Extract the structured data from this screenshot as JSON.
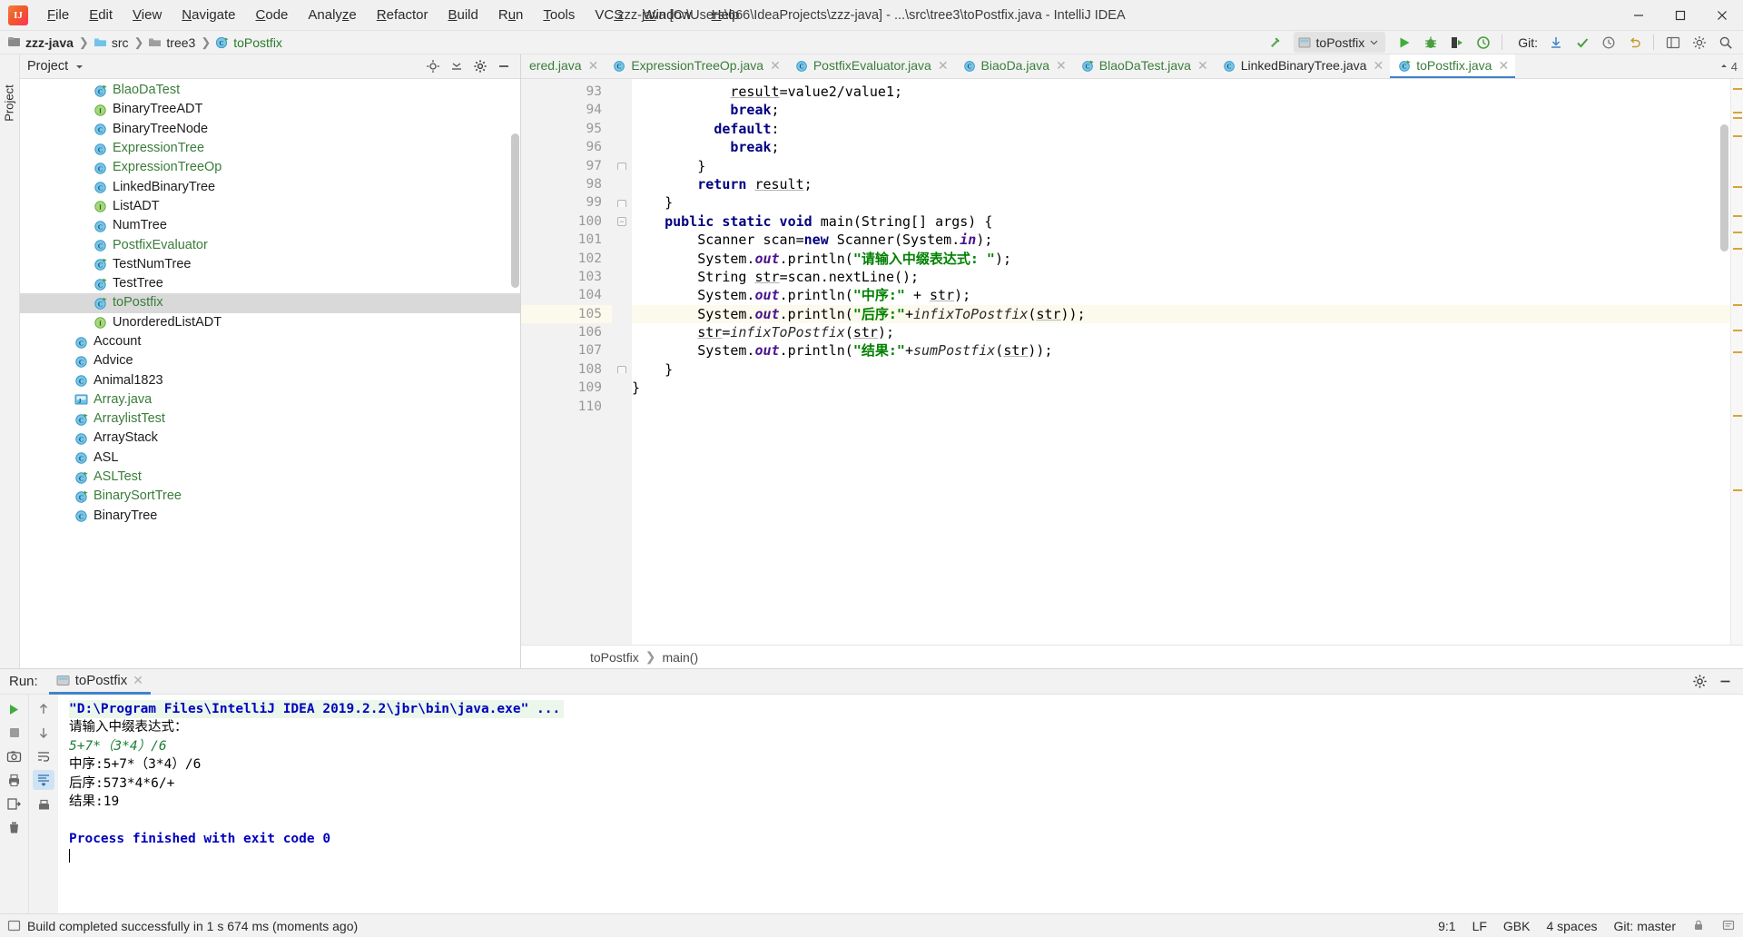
{
  "window": {
    "title": "zzz-java [C:\\Users\\666\\IdeaProjects\\zzz-java] - ...\\src\\tree3\\toPostfix.java - IntelliJ IDEA",
    "minimize": "—",
    "maximize": "☐",
    "close": "✕"
  },
  "menu": [
    "File",
    "Edit",
    "View",
    "Navigate",
    "Code",
    "Analyze",
    "Refactor",
    "Build",
    "Run",
    "Tools",
    "VCS",
    "Window",
    "Help"
  ],
  "breadcrumb": [
    {
      "label": "zzz-java",
      "icon": "project-icon",
      "style": "bold"
    },
    {
      "label": "src",
      "icon": "folder-icon",
      "style": "normal"
    },
    {
      "label": "tree3",
      "icon": "folder-icon",
      "style": "normal"
    },
    {
      "label": "toPostfix",
      "icon": "java-class-icon",
      "style": "green"
    }
  ],
  "toolbar": {
    "run_config_name": "toPostfix",
    "git_label": "Git:",
    "icons": [
      "build-hammer-icon",
      "run-icon",
      "debug-icon",
      "run-with-coverage-icon",
      "profile-icon",
      "vcs-update-icon",
      "vcs-commit-icon",
      "vcs-history-icon",
      "undo-icon",
      "settings-icon",
      "search-icon"
    ]
  },
  "project_panel": {
    "title": "Project",
    "header_icons": [
      "locate-icon",
      "collapse-all-icon",
      "settings-gear-icon",
      "hide-icon"
    ],
    "items": [
      {
        "label": "BlaoDaTest",
        "icon": "class-runnable",
        "green": true,
        "indent": 3
      },
      {
        "label": "BinaryTreeADT",
        "icon": "interface",
        "green": false,
        "indent": 3
      },
      {
        "label": "BinaryTreeNode",
        "icon": "class",
        "green": false,
        "indent": 3
      },
      {
        "label": "ExpressionTree",
        "icon": "class",
        "green": true,
        "indent": 3
      },
      {
        "label": "ExpressionTreeOp",
        "icon": "class",
        "green": true,
        "indent": 3
      },
      {
        "label": "LinkedBinaryTree",
        "icon": "class",
        "green": false,
        "indent": 3
      },
      {
        "label": "ListADT",
        "icon": "interface",
        "green": false,
        "indent": 3
      },
      {
        "label": "NumTree",
        "icon": "class",
        "green": false,
        "indent": 3
      },
      {
        "label": "PostfixEvaluator",
        "icon": "class",
        "green": true,
        "indent": 3
      },
      {
        "label": "TestNumTree",
        "icon": "class-runnable",
        "green": false,
        "indent": 3
      },
      {
        "label": "TestTree",
        "icon": "class-runnable",
        "green": false,
        "indent": 3
      },
      {
        "label": "toPostfix",
        "icon": "class-runnable",
        "green": true,
        "indent": 3,
        "selected": true
      },
      {
        "label": "UnorderedListADT",
        "icon": "interface",
        "green": false,
        "indent": 3
      },
      {
        "label": "Account",
        "icon": "class",
        "green": false,
        "indent": 2
      },
      {
        "label": "Advice",
        "icon": "class",
        "green": false,
        "indent": 2
      },
      {
        "label": "Animal1823",
        "icon": "class",
        "green": false,
        "indent": 2
      },
      {
        "label": "Array.java",
        "icon": "java-file",
        "green": true,
        "indent": 2
      },
      {
        "label": "ArraylistTest",
        "icon": "class-runnable",
        "green": true,
        "indent": 2
      },
      {
        "label": "ArrayStack",
        "icon": "class",
        "green": false,
        "indent": 2
      },
      {
        "label": "ASL",
        "icon": "class",
        "green": false,
        "indent": 2
      },
      {
        "label": "ASLTest",
        "icon": "class-runnable",
        "green": true,
        "indent": 2
      },
      {
        "label": "BinarySortTree",
        "icon": "class-runnable",
        "green": true,
        "indent": 2
      },
      {
        "label": "BinaryTree",
        "icon": "class",
        "green": false,
        "indent": 2
      }
    ]
  },
  "editor_tabs": [
    {
      "label": "ered.java",
      "green": true,
      "icon": "java-class-icon",
      "active": false,
      "clipped": true
    },
    {
      "label": "ExpressionTreeOp.java",
      "green": true,
      "icon": "java-class-icon",
      "active": false
    },
    {
      "label": "PostfixEvaluator.java",
      "green": true,
      "icon": "java-class-icon",
      "active": false
    },
    {
      "label": "BiaoDa.java",
      "green": true,
      "icon": "java-class-icon",
      "active": false
    },
    {
      "label": "BlaoDaTest.java",
      "green": true,
      "icon": "java-class-runnable-icon",
      "active": false
    },
    {
      "label": "LinkedBinaryTree.java",
      "green": false,
      "icon": "java-class-icon",
      "active": false
    },
    {
      "label": "toPostfix.java",
      "green": true,
      "icon": "java-class-runnable-icon",
      "active": true
    }
  ],
  "tab_overflow_count": "4",
  "editor": {
    "first_line": 93,
    "highlight_line": 105,
    "run_marker_line": 100,
    "lines": [
      {
        "n": 93,
        "indent": 12,
        "tokens": [
          {
            "t": "result",
            "c": "var-u"
          },
          {
            "t": "=value2/value1;",
            "c": ""
          }
        ]
      },
      {
        "n": 94,
        "indent": 12,
        "tokens": [
          {
            "t": "break",
            "c": "kw"
          },
          {
            "t": ";",
            "c": ""
          }
        ]
      },
      {
        "n": 95,
        "indent": 10,
        "tokens": [
          {
            "t": "default",
            "c": "kw"
          },
          {
            "t": ":",
            "c": ""
          }
        ]
      },
      {
        "n": 96,
        "indent": 12,
        "tokens": [
          {
            "t": "break",
            "c": "kw"
          },
          {
            "t": ";",
            "c": ""
          }
        ]
      },
      {
        "n": 97,
        "indent": 8,
        "tokens": [
          {
            "t": "}",
            "c": ""
          }
        ],
        "fold": "end"
      },
      {
        "n": 98,
        "indent": 8,
        "tokens": [
          {
            "t": "return",
            "c": "kw"
          },
          {
            "t": " ",
            "c": ""
          },
          {
            "t": "result",
            "c": "var-u"
          },
          {
            "t": ";",
            "c": ""
          }
        ]
      },
      {
        "n": 99,
        "indent": 4,
        "tokens": [
          {
            "t": "}",
            "c": ""
          }
        ],
        "fold": "end"
      },
      {
        "n": 100,
        "indent": 4,
        "tokens": [
          {
            "t": "public static void",
            "c": "kw"
          },
          {
            "t": " main(String[] args) {",
            "c": ""
          }
        ],
        "fold": "start",
        "run": true
      },
      {
        "n": 101,
        "indent": 8,
        "tokens": [
          {
            "t": "Scanner scan=",
            "c": ""
          },
          {
            "t": "new",
            "c": "kw"
          },
          {
            "t": " Scanner(System.",
            "c": ""
          },
          {
            "t": "in",
            "c": "fld"
          },
          {
            "t": ");",
            "c": ""
          }
        ]
      },
      {
        "n": 102,
        "indent": 8,
        "tokens": [
          {
            "t": "System.",
            "c": ""
          },
          {
            "t": "out",
            "c": "fld"
          },
          {
            "t": ".println(",
            "c": ""
          },
          {
            "t": "\"请输入中缀表达式: \"",
            "c": "str"
          },
          {
            "t": ");",
            "c": ""
          }
        ]
      },
      {
        "n": 103,
        "indent": 8,
        "tokens": [
          {
            "t": "String ",
            "c": ""
          },
          {
            "t": "str",
            "c": "var-u"
          },
          {
            "t": "=scan.nextLine();",
            "c": ""
          }
        ]
      },
      {
        "n": 104,
        "indent": 8,
        "tokens": [
          {
            "t": "System.",
            "c": ""
          },
          {
            "t": "out",
            "c": "fld"
          },
          {
            "t": ".println(",
            "c": ""
          },
          {
            "t": "\"中序:\"",
            "c": "str"
          },
          {
            "t": " + ",
            "c": ""
          },
          {
            "t": "str",
            "c": "var-u"
          },
          {
            "t": ");",
            "c": ""
          }
        ]
      },
      {
        "n": 105,
        "indent": 8,
        "tokens": [
          {
            "t": "System.",
            "c": ""
          },
          {
            "t": "out",
            "c": "fld"
          },
          {
            "t": ".println(",
            "c": ""
          },
          {
            "t": "\"后序:\"",
            "c": "str"
          },
          {
            "t": "+",
            "c": ""
          },
          {
            "t": "infixToPostfix",
            "c": "mth"
          },
          {
            "t": "(",
            "c": ""
          },
          {
            "t": "str",
            "c": "var-u"
          },
          {
            "t": "));",
            "c": ""
          }
        ],
        "highlight": true
      },
      {
        "n": 106,
        "indent": 8,
        "tokens": [
          {
            "t": "str",
            "c": "var-u"
          },
          {
            "t": "=",
            "c": ""
          },
          {
            "t": "infixToPostfix",
            "c": "mth"
          },
          {
            "t": "(",
            "c": ""
          },
          {
            "t": "str",
            "c": "var-u"
          },
          {
            "t": ");",
            "c": ""
          }
        ]
      },
      {
        "n": 107,
        "indent": 8,
        "tokens": [
          {
            "t": "System.",
            "c": ""
          },
          {
            "t": "out",
            "c": "fld"
          },
          {
            "t": ".println(",
            "c": ""
          },
          {
            "t": "\"结果:\"",
            "c": "str"
          },
          {
            "t": "+",
            "c": ""
          },
          {
            "t": "sumPostfix",
            "c": "mth"
          },
          {
            "t": "(",
            "c": ""
          },
          {
            "t": "str",
            "c": "var-u"
          },
          {
            "t": "));",
            "c": ""
          }
        ]
      },
      {
        "n": 108,
        "indent": 4,
        "tokens": [
          {
            "t": "}",
            "c": ""
          }
        ],
        "fold": "end"
      },
      {
        "n": 109,
        "indent": 0,
        "tokens": [
          {
            "t": "}",
            "c": ""
          }
        ]
      },
      {
        "n": 110,
        "indent": 0,
        "tokens": []
      }
    ],
    "bottom_breadcrumb": [
      "toPostfix",
      "main()"
    ]
  },
  "run_panel": {
    "label": "Run:",
    "tab_name": "toPostfix",
    "console_lines": [
      {
        "text": "\"D:\\Program Files\\IntelliJ IDEA 2019.2.2\\jbr\\bin\\java.exe\" ...",
        "type": "cmd"
      },
      {
        "text": "请输入中缀表达式：",
        "type": "plain"
      },
      {
        "text": "5+7*（3*4）/6",
        "type": "input"
      },
      {
        "text": "中序:5+7*（3*4）/6",
        "type": "plain"
      },
      {
        "text": "后序:573*4*6/+",
        "type": "plain"
      },
      {
        "text": "结果:19",
        "type": "plain"
      },
      {
        "text": "",
        "type": "plain"
      },
      {
        "text": "Process finished with exit code 0",
        "type": "proc"
      },
      {
        "text": "",
        "type": "caret"
      }
    ],
    "side_icons": [
      "rerun-icon",
      "stop-icon",
      "screenshot-icon",
      "print-icon",
      "export-icon",
      "trash-icon"
    ],
    "nav_icons": [
      "up-arrow-icon",
      "down-arrow-icon",
      "soft-wrap-icon",
      "scroll-end-icon"
    ],
    "header_right_icons": [
      "settings-gear-icon",
      "hide-icon"
    ]
  },
  "statusbar": {
    "message": "Build completed successfully in 1 s 674 ms (moments ago)",
    "caret_position": "9:1",
    "line_separator": "LF",
    "encoding": "GBK",
    "indent": "4 spaces",
    "branch": "Git: master"
  },
  "colors": {
    "accent_blue": "#4083c9",
    "green_text": "#3a7d3a",
    "keyword": "#000080",
    "string": "#008000",
    "field": "#4a148c",
    "gutter_bg": "#f2f2f2",
    "highlight_line_bg": "#fcfaec",
    "selection_bg": "#d9d9d9"
  }
}
